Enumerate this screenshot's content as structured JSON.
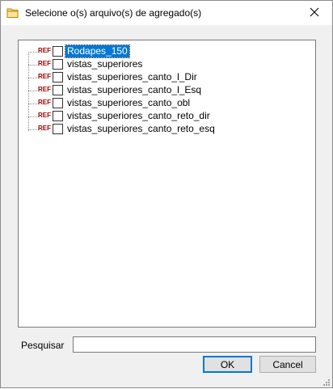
{
  "window": {
    "title": "Selecione o(s) arquivo(s) de agregado(s)",
    "close_glyph": "✕",
    "title_icon": "folder-icon"
  },
  "tree": {
    "ref_badge": "REF",
    "items": [
      {
        "label": "Rodapes_150",
        "checked": false,
        "selected": true
      },
      {
        "label": "vistas_superiores",
        "checked": false,
        "selected": false
      },
      {
        "label": "vistas_superiores_canto_l_Dir",
        "checked": false,
        "selected": false
      },
      {
        "label": "vistas_superiores_canto_l_Esq",
        "checked": false,
        "selected": false
      },
      {
        "label": "vistas_superiores_canto_obl",
        "checked": false,
        "selected": false
      },
      {
        "label": "vistas_superiores_canto_reto_dir",
        "checked": false,
        "selected": false
      },
      {
        "label": "vistas_superiores_canto_reto_esq",
        "checked": false,
        "selected": false
      }
    ]
  },
  "search": {
    "label": "Pesquisar",
    "value": ""
  },
  "buttons": {
    "ok": "OK",
    "cancel": "Cancel"
  },
  "colors": {
    "selection": "#0078d7",
    "ref_badge": "#a00000"
  }
}
